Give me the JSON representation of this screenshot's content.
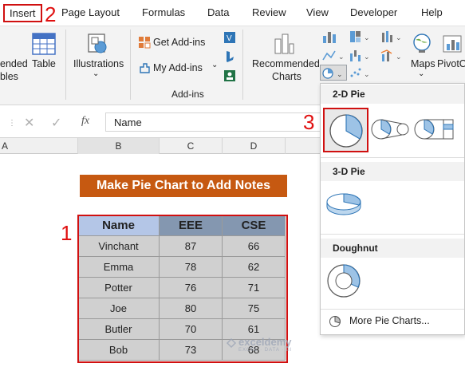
{
  "tabs": {
    "insert": "Insert",
    "page_layout": "Page Layout",
    "formulas": "Formulas",
    "data": "Data",
    "review": "Review",
    "view": "View",
    "developer": "Developer",
    "help": "Help"
  },
  "ribbon": {
    "recommended_tables_label_1": "ended",
    "recommended_tables_label_2": "bles",
    "table_label": "Table",
    "illustrations_label": "Illustrations",
    "get_addins_label": "Get Add-ins",
    "my_addins_label": "My Add-ins",
    "addins_group_label": "Add-ins",
    "recommended_charts_label_1": "Recommended",
    "recommended_charts_label_2": "Charts",
    "maps_label": "Maps",
    "pivotchart_label": "PivotC"
  },
  "formula_bar": {
    "content": "Name",
    "fx": "fx"
  },
  "columns": [
    "A",
    "B",
    "C",
    "D"
  ],
  "sheet": {
    "title": "Make Pie Chart to Add Notes",
    "table": {
      "headers": [
        "Name",
        "EEE",
        "CSE"
      ],
      "rows": [
        [
          "Vinchant",
          "87",
          "66"
        ],
        [
          "Emma",
          "78",
          "62"
        ],
        [
          "Potter",
          "76",
          "71"
        ],
        [
          "Joe",
          "80",
          "75"
        ],
        [
          "Butler",
          "70",
          "61"
        ],
        [
          "Bob",
          "73",
          "68"
        ]
      ]
    }
  },
  "dropdown": {
    "section_2d": "2-D Pie",
    "section_3d": "3-D Pie",
    "section_doughnut": "Doughnut",
    "more": "More Pie Charts..."
  },
  "annotations": {
    "step1": "1",
    "step2": "2",
    "step3": "3"
  },
  "watermark": {
    "brand": "exceldemy",
    "tagline": "EXCEL · DATA · BI"
  },
  "colors": {
    "red_annotation": "#d01010",
    "title_fill": "#c65911",
    "header_name_fill": "#b4c6e7",
    "header_score_fill": "#8497b0",
    "body_fill": "#d0d0d0",
    "pie_blue": "#9dc3e6",
    "pie_outline": "#2e75b6"
  }
}
